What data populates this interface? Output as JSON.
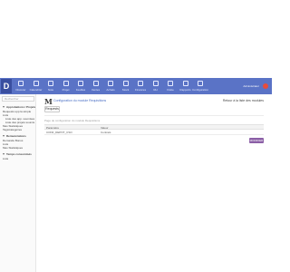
{
  "app": {
    "logo": "D"
  },
  "topbar": {
    "items": [
      {
        "label": "Discuter",
        "icon": "chat-icon"
      },
      {
        "label": "Calendrier",
        "icon": "calendar-icon"
      },
      {
        "label": "Note",
        "icon": "note-icon"
      },
      {
        "label": "Projet",
        "icon": "project-icon"
      },
      {
        "label": "Feuilles",
        "icon": "timesheet-icon"
      },
      {
        "label": "Ventes",
        "icon": "sales-icon"
      },
      {
        "label": "Achats",
        "icon": "purchase-icon"
      },
      {
        "label": "Stock",
        "icon": "stock-icon"
      },
      {
        "label": "Finances",
        "icon": "finance-icon"
      },
      {
        "label": "RH",
        "icon": "hr-icon"
      },
      {
        "label": "Flotte",
        "icon": "fleet-icon"
      },
      {
        "label": "Rapports",
        "icon": "reports-icon"
      },
      {
        "label": "Configuration",
        "icon": "settings-icon"
      }
    ],
    "user": "Administrator"
  },
  "sidebar": {
    "search_placeholder": "Rechercher",
    "section1": {
      "title": "Approbations / Projets",
      "items": [
        "Requests upp la simple",
        "Lists",
        "Liste des app. soumises",
        "Liste des projets soumis",
        "Mes Statistiques",
        "Tags/catégories"
      ]
    },
    "section2": {
      "title": "Remunérations",
      "items": [
        "Demande Bonus",
        "Lists",
        "Mes Statistiques"
      ]
    },
    "section3": {
      "title": "Temps consommés",
      "items": [
        "Lists"
      ]
    }
  },
  "main": {
    "app_icon": "M",
    "breadcrumb": "Configuration du module Requisitions",
    "top_right_link": "Retour à la liste des modules",
    "action_button": "Requests",
    "caption": "Page de configuration du module Requisitions",
    "table": {
      "headers": [
        "Paramètre",
        "Valeur"
      ],
      "rows": [
        [
          "CONF_DEPOT_CSO",
          "Contrats"
        ]
      ]
    },
    "save_button": "MODIFIER"
  }
}
